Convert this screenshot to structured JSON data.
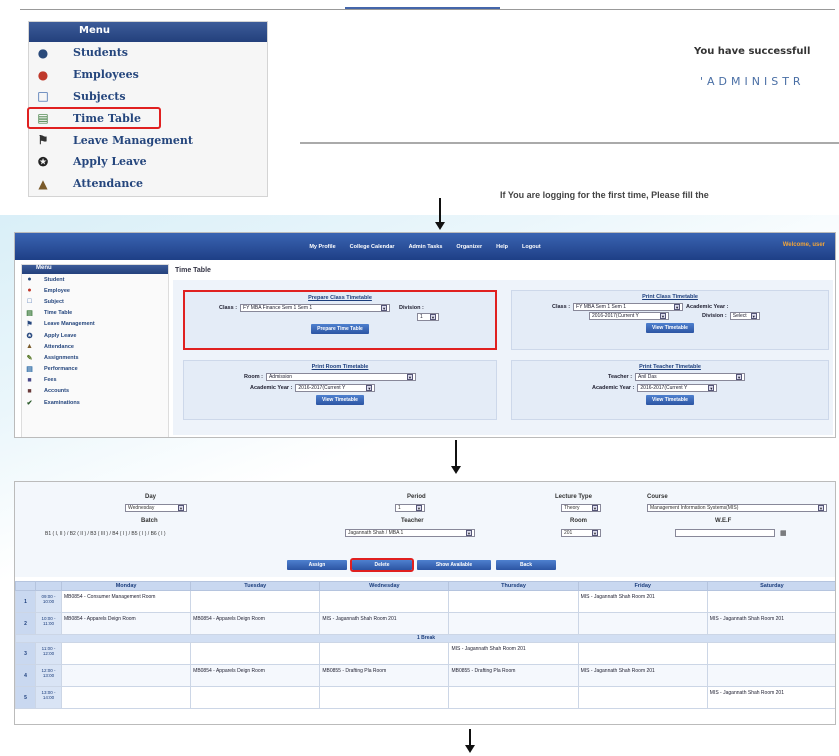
{
  "panel1": {
    "menu_title": "Menu",
    "menu_items": [
      {
        "label": "Students",
        "icon": "student-icon"
      },
      {
        "label": "Employees",
        "icon": "employee-icon"
      },
      {
        "label": "Subjects",
        "icon": "book-icon"
      },
      {
        "label": "Time Table",
        "icon": "timetable-icon"
      },
      {
        "label": "Leave Management",
        "icon": "leave-icon"
      },
      {
        "label": "Apply Leave",
        "icon": "walking-person-icon"
      },
      {
        "label": "Attendance",
        "icon": "attendance-icon"
      }
    ],
    "welcome_text": "You have successfull",
    "admin_text": "'ADMINISTR",
    "footer_text": "If You are logging for the first time, Please fill the"
  },
  "panel2": {
    "nav": [
      "My Profile",
      "College Calendar",
      "Admin Tasks",
      "Organizer",
      "Help",
      "Logout"
    ],
    "welcome": "Welcome, user",
    "menu_title": "Menu",
    "menu_items": [
      "Student",
      "Employee",
      "Subject",
      "Time Table",
      "Leave Management",
      "Apply Leave",
      "Attendance",
      "Assignments",
      "Performance",
      "Fees",
      "Accounts",
      "Examinations"
    ],
    "page_title": "Time Table",
    "prepare": {
      "title": "Prepare Class Timetable",
      "class_label": "Class :",
      "class_value": "FY MBA Finance Sem 1 Sem 1",
      "division_label": "Division :",
      "division_value": "1",
      "button": "Prepare Time Table"
    },
    "print_class": {
      "title": "Print Class Timetable",
      "class_label": "Class :",
      "class_value": "FY MBA Sem 1 Sem 1",
      "year_label": "Academic Year :",
      "year_value": "2016-2017(Current Y",
      "division_label": "Division :",
      "division_value": "Select",
      "button": "View Timetable"
    },
    "print_room": {
      "title": "Print Room Timetable",
      "room_label": "Room :",
      "room_value": "Admission",
      "year_label": "Academic Year :",
      "year_value": "2016-2017(Current Y",
      "button": "View Timetable"
    },
    "print_teacher": {
      "title": "Print Teacher Timetable",
      "teacher_label": "Teacher :",
      "teacher_value": "Anil Das",
      "year_label": "Academic Year :",
      "year_value": "2016-2017(Current Y",
      "button": "View Timetable"
    }
  },
  "panel3": {
    "filters": {
      "day_label": "Day",
      "day_value": "Wednesday",
      "period_label": "Period",
      "period_value": "1",
      "lecture_type_label": "Lecture Type",
      "lecture_type_value": "Theory",
      "course_label": "Course",
      "course_value": "Management Information Systems(MIS)",
      "batch_label": "Batch",
      "batch_options": "B1 ( I, II ) / B2 ( II ) / B3 ( III ) / B4 ( I ) / B5 ( I ) / B6 ( I )",
      "teacher_label": "Teacher",
      "teacher_value": "Jagannath Shah / MBA 1",
      "room_label": "Room",
      "room_value": "201",
      "wef_label": "W.E.F",
      "wef_value": ""
    },
    "buttons": [
      "Assign",
      "Delete",
      "Show Available",
      "Back"
    ],
    "columns": [
      "Monday",
      "Tuesday",
      "Wednesday",
      "Thursday",
      "Friday",
      "Saturday"
    ],
    "rows": [
      {
        "num": "1",
        "time": "09:00 - 10:00",
        "cells": [
          "MB0854 - Consumer Management Room",
          "",
          "",
          "",
          "MIS - Jagannath Shah Room 201",
          ""
        ]
      },
      {
        "num": "2",
        "time": "10:00 - 11:00",
        "cells": [
          "MB0854 - Apparels Deign Room",
          "MB0854 - Apparels Deign Room",
          "MIS - Jagannath Shah Room 201",
          "",
          "",
          "MIS - Jagannath Shah Room 201"
        ]
      },
      {
        "break": "1 Break"
      },
      {
        "num": "3",
        "time": "11:00 - 12:00",
        "cells": [
          "",
          "",
          "",
          "MIS - Jagannath Shah Room 201",
          "",
          ""
        ]
      },
      {
        "num": "4",
        "time": "12:00 - 13:00",
        "cells": [
          "",
          "MB0854 - Apparels Deign Room",
          "MB0855 - Drafting Pla Room",
          "MB0855 - Drafting Pla Room",
          "MIS - Jagannath Shah Room 201",
          ""
        ]
      },
      {
        "num": "5",
        "time": "13:00 - 14:00",
        "cells": [
          "",
          "",
          "",
          "",
          "",
          "MIS - Jagannath Shah Room 201"
        ]
      }
    ]
  }
}
